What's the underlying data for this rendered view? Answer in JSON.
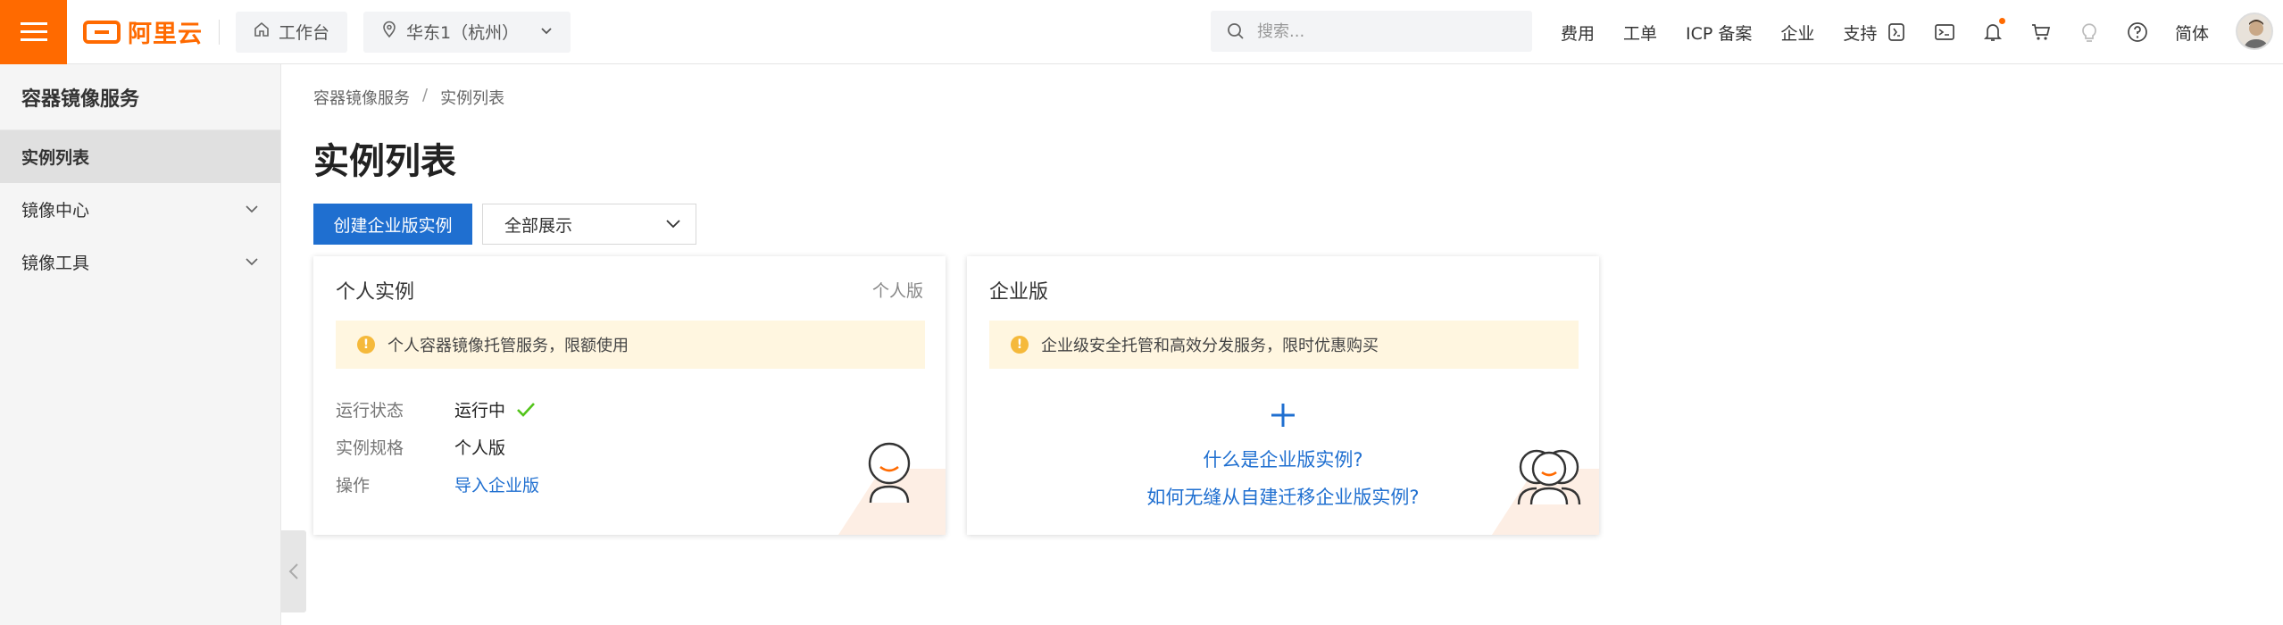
{
  "header": {
    "logo_text": "阿里云",
    "workbench_label": "工作台",
    "region_label": "华东1（杭州）",
    "search_placeholder": "搜索...",
    "links": [
      "费用",
      "工单",
      "ICP 备案",
      "企业",
      "支持"
    ],
    "lang_label": "简体"
  },
  "sidebar": {
    "title": "容器镜像服务",
    "items": [
      {
        "label": "实例列表"
      },
      {
        "label": "镜像中心"
      },
      {
        "label": "镜像工具"
      }
    ]
  },
  "breadcrumb": [
    "容器镜像服务",
    "/",
    "实例列表"
  ],
  "main": {
    "title": "实例列表",
    "create_button": "创建企业版实例",
    "filter_select": "全部展示"
  },
  "cards": {
    "personal": {
      "title": "个人实例",
      "tag": "个人版",
      "notice": "个人容器镜像托管服务，限额使用",
      "rows": [
        {
          "key": "运行状态",
          "value": "运行中"
        },
        {
          "key": "实例规格",
          "value": "个人版"
        },
        {
          "key": "操作",
          "value": "导入企业版"
        }
      ]
    },
    "enterprise": {
      "title": "企业版",
      "notice": "企业级安全托管和高效分发服务，限时优惠购买",
      "link1": "什么是企业版实例?",
      "link2": "如何无缝从自建迁移企业版实例?"
    }
  },
  "colors": {
    "brand": "#ff6a00",
    "primary": "#1f6fd0",
    "notice_bg": "#fff6e0",
    "success": "#52c41a"
  }
}
